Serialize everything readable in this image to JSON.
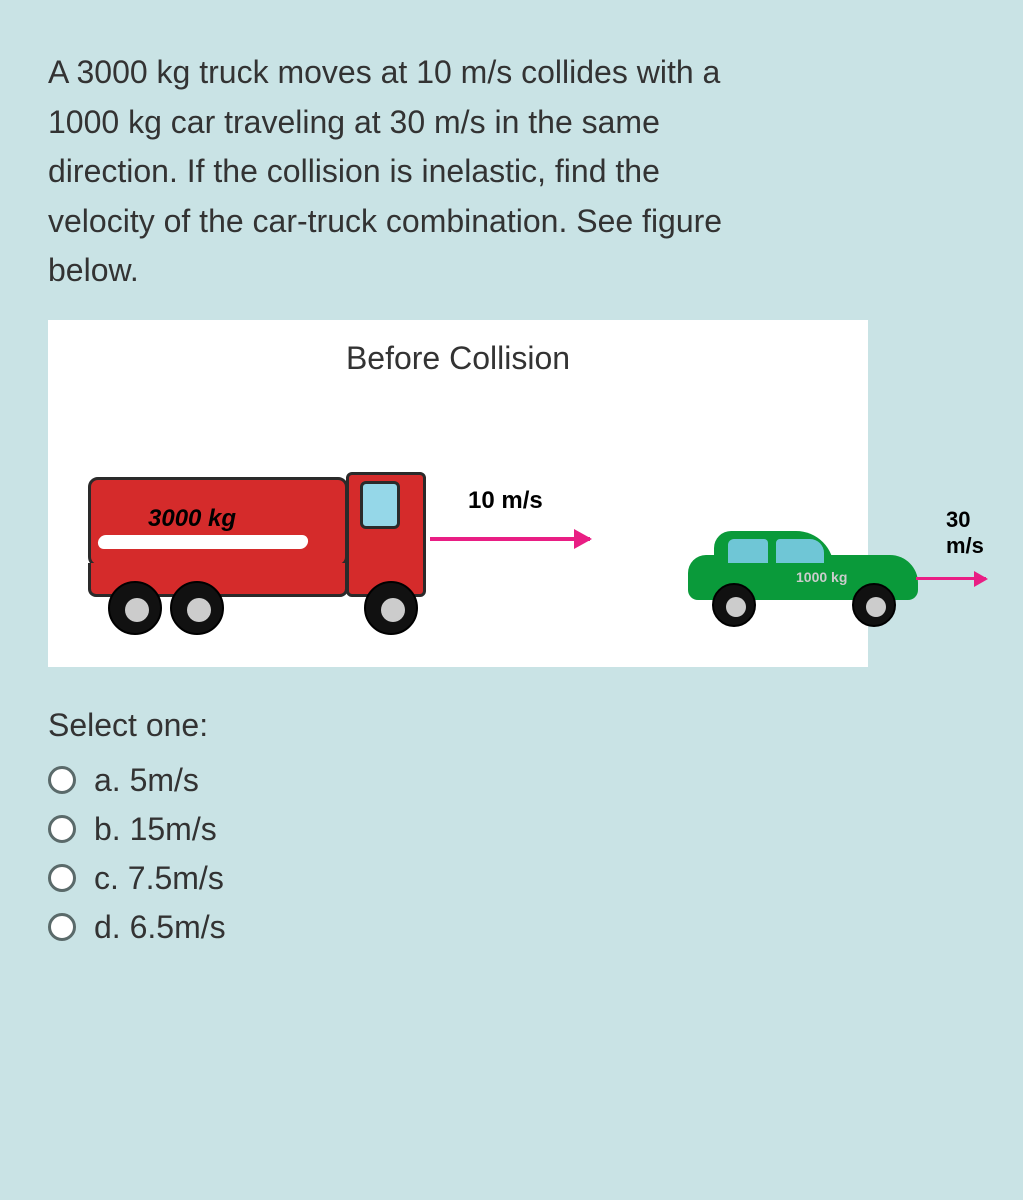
{
  "question": "A 3000 kg truck moves at 10 m/s collides with a 1000 kg car traveling at 30 m/s in the same direction. If the collision is inelastic, find the velocity of the car-truck combination. See figure below.",
  "figure": {
    "title": "Before Collision",
    "truck_mass": "3000 kg",
    "truck_speed": "10 m/s",
    "car_mass": "1000 kg",
    "car_speed": "30 m/s"
  },
  "select_label": "Select one:",
  "options": {
    "a": "a. 5m/s",
    "b": "b. 15m/s",
    "c": "c. 7.5m/s",
    "d": "d. 6.5m/s"
  }
}
